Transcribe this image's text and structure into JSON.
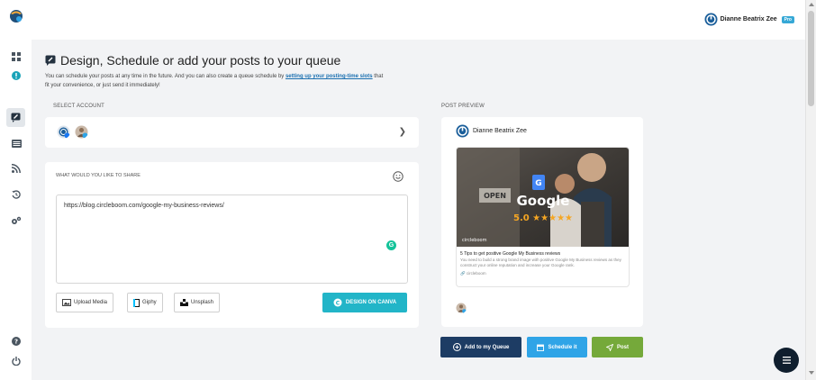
{
  "user": {
    "name": "Dianne Beatrix Zee",
    "badge": "Pro"
  },
  "page": {
    "title": "Design, Schedule or add your posts to your queue",
    "intro_pre": "You can schedule your posts at any time in the future. And you can also create a queue schedule by ",
    "intro_link": "setting up your posting-time slots",
    "intro_post": " that fit your convenience, or just send it immediately!"
  },
  "account": {
    "label": "SELECT ACCOUNT"
  },
  "compose": {
    "label": "WHAT WOULD YOU LIKE TO SHARE",
    "text": "https://blog.circleboom.com/google-my-business-reviews/",
    "grammarly_letter": "G",
    "upload_label": "Upload Media",
    "giphy_label": "Giphy",
    "unsplash_label": "Unsplash",
    "canva_label": "DESIGN ON CANVA"
  },
  "preview": {
    "label": "POST PREVIEW",
    "name": "Dianne Beatrix Zee",
    "image_brand": "Google",
    "image_rating": "5.0 ★★★★★",
    "image_watermark": "circleboom",
    "image_sign": "OPEN",
    "link_title": "5 Tips to get positive Google My Business reviews",
    "link_desc": "You need to build a strong brand image with positive Google My Business reviews as they construct your online reputation and increase your Google rank.",
    "link_domain": "circleboom"
  },
  "actions": {
    "queue_label": "Add to my Queue",
    "schedule_label": "Schedule it",
    "post_label": "Post"
  },
  "colors": {
    "accent": "#22b5c8",
    "queue": "#1d3c64",
    "schedule": "#2fa4e7",
    "post": "#75a93a",
    "fab": "#0f1e2e"
  }
}
